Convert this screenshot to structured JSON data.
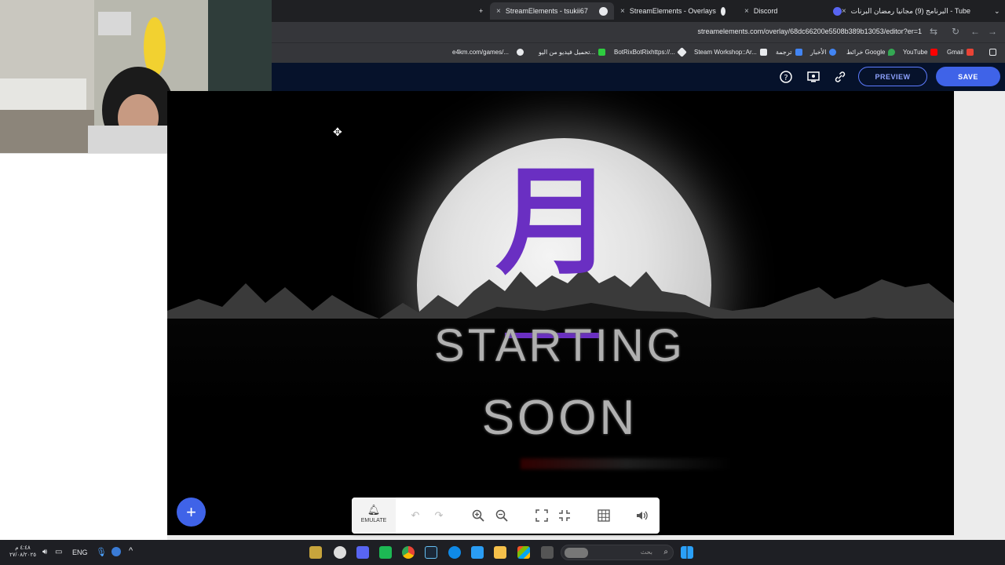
{
  "browser": {
    "tabs": [
      {
        "label": "StreamElements - tsukii67",
        "active": true
      },
      {
        "label": "StreamElements - Overlays",
        "active": false
      },
      {
        "label": "Discord",
        "active": false
      },
      {
        "label": "Tube - البرنامج (9) مجانيا رمضان البرنات",
        "active": false
      }
    ],
    "new_tab": "+",
    "url": "streamelements.com/overlay/68dc66200e5508b389b13053/editor?er=1",
    "bookmarks": [
      {
        "label": "e4km.com/games/...",
        "color": "#888888"
      },
      {
        "label": "تحميل فيديو من اليو...",
        "color": "#e8eaed"
      },
      {
        "label": "BotRixBotRixhttps://...",
        "color": "#2ecc40"
      },
      {
        "label": "Steam Workshop::Ar...",
        "color": "#e8eaed"
      },
      {
        "label": "ترجمة",
        "color": "#4285f4"
      },
      {
        "label": "الأخبار",
        "color": "#4285f4"
      },
      {
        "label": "خرائط Google",
        "color": "#34a853"
      },
      {
        "label": "YouTube",
        "color": "#ff0000"
      },
      {
        "label": "Gmail",
        "color": "#ea4335"
      }
    ]
  },
  "editor": {
    "preview_label": "PREVIEW",
    "save_label": "SAVE",
    "emulate_label": "EMULATE",
    "add_label": "+"
  },
  "overlay": {
    "kanji": "月",
    "line1": "STARTING",
    "line2": "SOON"
  },
  "taskbar": {
    "lang": "ENG",
    "time": "٤:٤٨ م",
    "date": "٢٧/٠٨/٢٠٢٥",
    "search_placeholder": "بحث"
  },
  "colors": {
    "accent": "#3f63e8",
    "kanji": "#6a2fc2",
    "header": "#06122b"
  }
}
